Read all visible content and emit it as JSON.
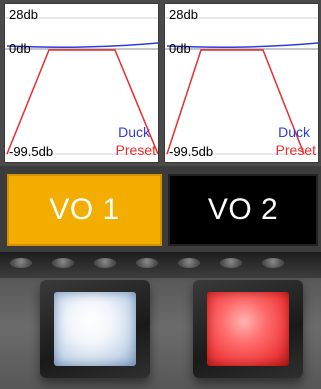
{
  "graphs": [
    {
      "top_label": "28db",
      "zero_label": "0db",
      "bottom_label": "-99.5db",
      "duck_label": "Duck",
      "preset_label": "Preset"
    },
    {
      "top_label": "28db",
      "zero_label": "0db",
      "bottom_label": "-99.5db",
      "duck_label": "Duck",
      "preset_label": "Preset"
    }
  ],
  "colors": {
    "duck": "#2a3dd6",
    "preset": "#ea2d2d",
    "vo1_bg": "#f2ad00",
    "vo2_bg": "#000000"
  },
  "channels": [
    {
      "label": "VO 1",
      "button_light": "white"
    },
    {
      "label": "VO 2",
      "button_light": "red"
    }
  ]
}
